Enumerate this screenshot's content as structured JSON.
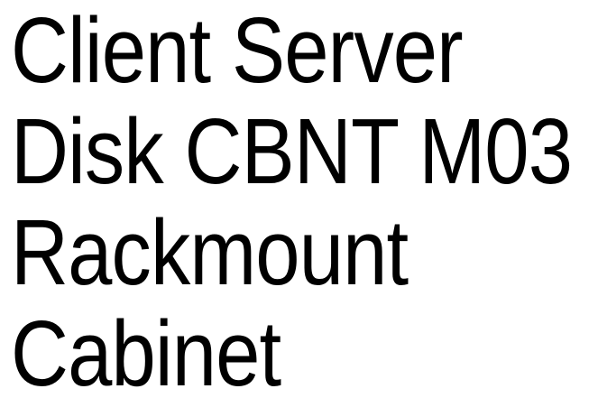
{
  "label": {
    "lines": [
      "Client Server",
      "Disk CBNT M03",
      "Rackmount",
      "Cabinet"
    ]
  }
}
